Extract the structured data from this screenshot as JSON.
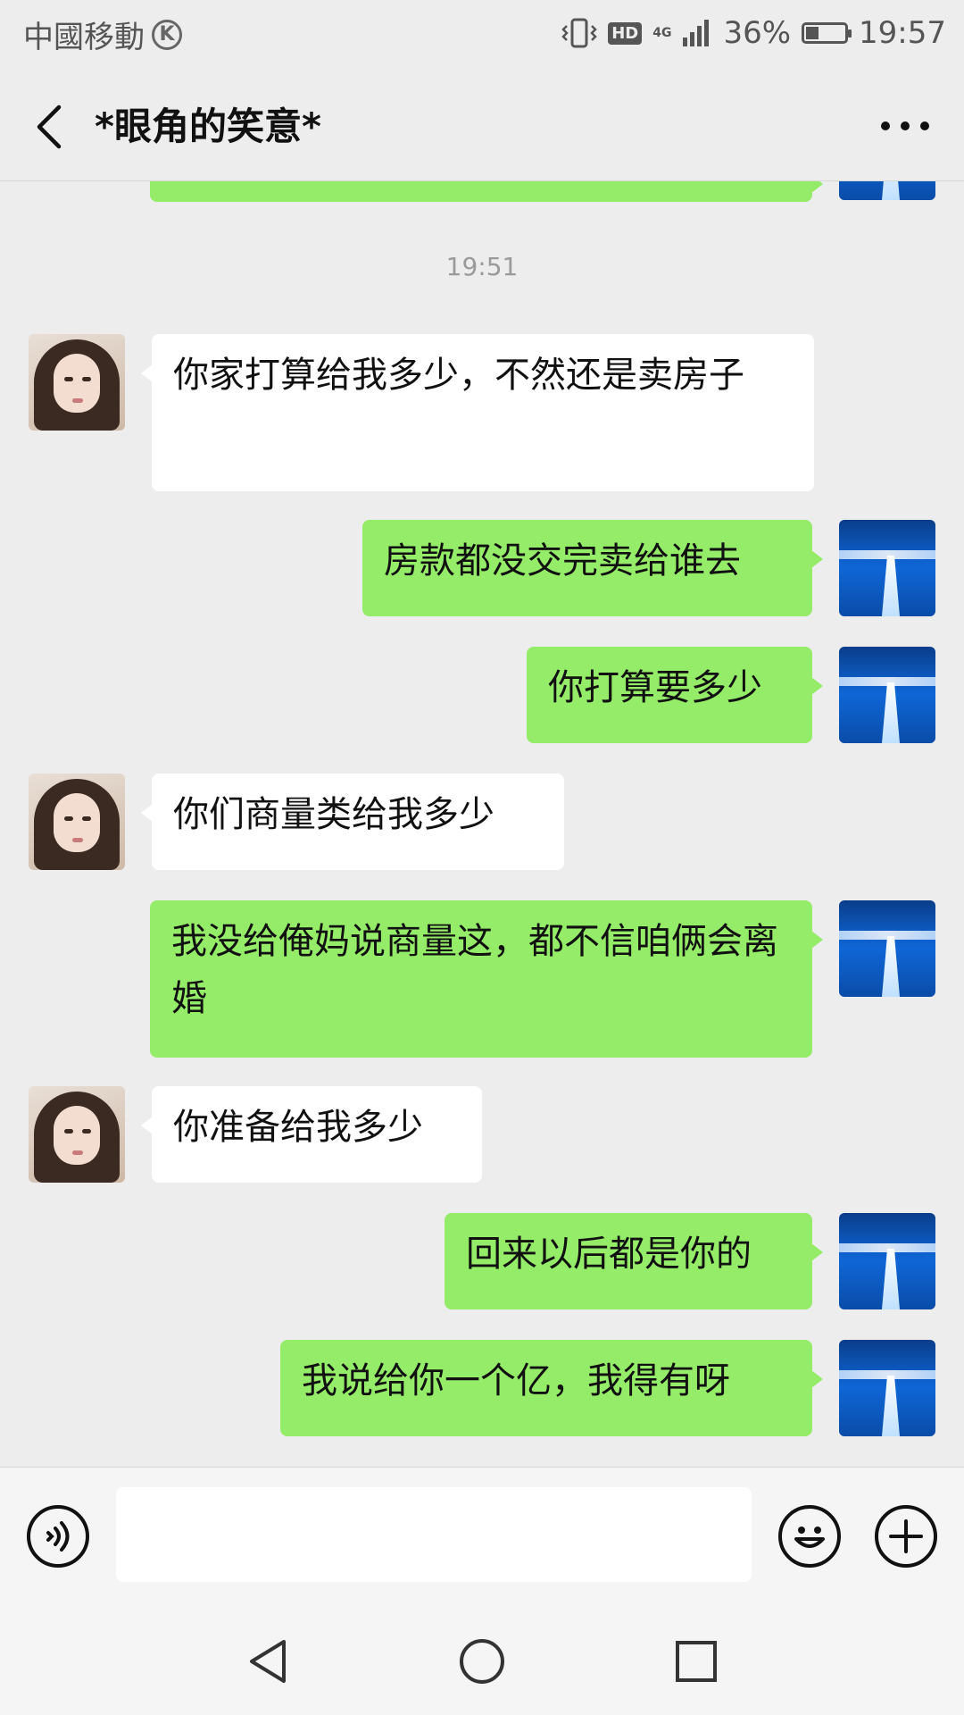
{
  "status_bar": {
    "carrier": "中國移動",
    "carrier_badge": "K",
    "hd": "HD",
    "network": "4G",
    "battery": "36%",
    "battery_level": 0.36,
    "time": "19:57"
  },
  "header": {
    "title": "*眼角的笑意*",
    "back_icon": "chevron-left-icon",
    "more_icon": "more-dots-icon"
  },
  "chat": {
    "timestamp": "19:51",
    "messages": [
      {
        "from": "her",
        "text": "你家打算给我多少，不然还是卖房子"
      },
      {
        "from": "me",
        "text": "房款都没交完卖给谁去"
      },
      {
        "from": "me",
        "text": "你打算要多少"
      },
      {
        "from": "her",
        "text": "你们商量类给我多少"
      },
      {
        "from": "me",
        "text": "我没给俺妈说商量这，都不信咱俩会离婚"
      },
      {
        "from": "her",
        "text": "你准备给我多少"
      },
      {
        "from": "me",
        "text": "回来以后都是你的"
      },
      {
        "from": "me",
        "text": "我说给你一个亿，我得有呀"
      }
    ]
  },
  "input_bar": {
    "voice_icon": "voice-icon",
    "message_value": "",
    "emoji_icon": "emoji-icon",
    "plus_icon": "plus-icon"
  },
  "nav_bar": {
    "back_icon": "triangle-back-icon",
    "home_icon": "circle-home-icon",
    "recents_icon": "square-recents-icon"
  },
  "colors": {
    "my_bubble": "#95ec69",
    "her_bubble": "#ffffff",
    "background": "#ededed"
  }
}
